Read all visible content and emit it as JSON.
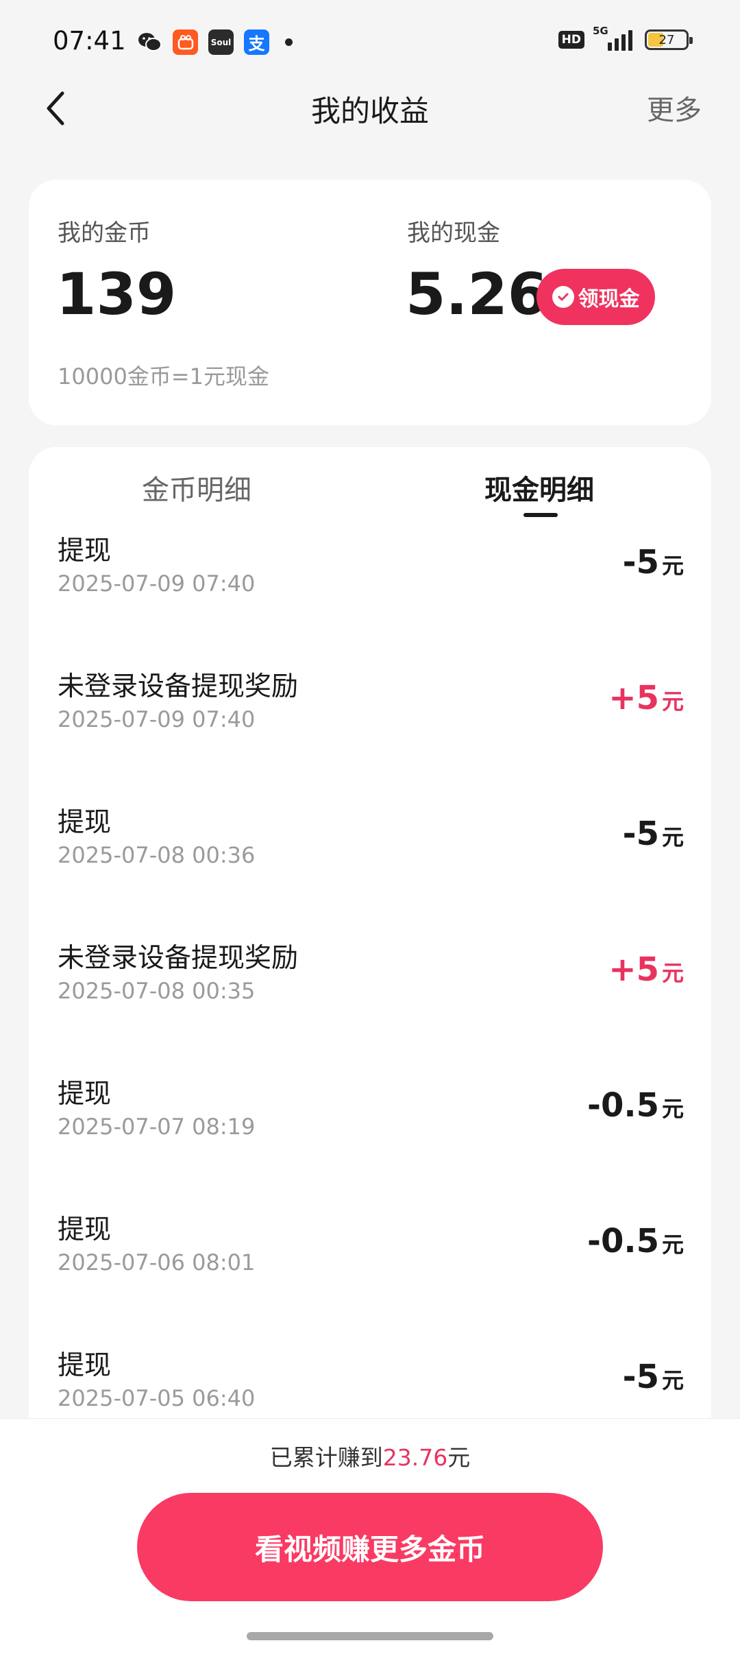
{
  "status_bar": {
    "time": "07:41",
    "app_icons": [
      "wechat-icon",
      "kuaishou-icon",
      "soul-icon",
      "alipay-icon"
    ],
    "soul_label": "Soul",
    "alipay_label": "支",
    "hd_label": "HD",
    "network_label": "5G",
    "battery_level": "27"
  },
  "header": {
    "title": "我的收益",
    "more_label": "更多"
  },
  "balance": {
    "coins_label": "我的金币",
    "coins_value": "139",
    "cash_label": "我的现金",
    "cash_value": "5.26",
    "claim_label": "领现金",
    "rate_text": "10000金币=1元现金"
  },
  "tabs": {
    "coin_detail": "金币明细",
    "cash_detail": "现金明细",
    "active": "cash_detail"
  },
  "transactions": [
    {
      "title": "提现",
      "time": "2025-07-09 07:40",
      "amount": "-5",
      "unit": "元",
      "type": "minus"
    },
    {
      "title": "未登录设备提现奖励",
      "time": "2025-07-09 07:40",
      "amount": "+5",
      "unit": "元",
      "type": "plus"
    },
    {
      "title": "提现",
      "time": "2025-07-08 00:36",
      "amount": "-5",
      "unit": "元",
      "type": "minus"
    },
    {
      "title": "未登录设备提现奖励",
      "time": "2025-07-08 00:35",
      "amount": "+5",
      "unit": "元",
      "type": "plus"
    },
    {
      "title": "提现",
      "time": "2025-07-07 08:19",
      "amount": "-0.5",
      "unit": "元",
      "type": "minus"
    },
    {
      "title": "提现",
      "time": "2025-07-06 08:01",
      "amount": "-0.5",
      "unit": "元",
      "type": "minus"
    },
    {
      "title": "提现",
      "time": "2025-07-05 06:40",
      "amount": "-5",
      "unit": "元",
      "type": "minus"
    }
  ],
  "footer": {
    "total_prefix": "已累计赚到",
    "total_value": "23.76",
    "total_suffix": "元",
    "watch_button": "看视频赚更多金币"
  },
  "colors": {
    "accent": "#f0325e",
    "plus_amount": "#e8335f",
    "background": "#f5f5f5"
  }
}
